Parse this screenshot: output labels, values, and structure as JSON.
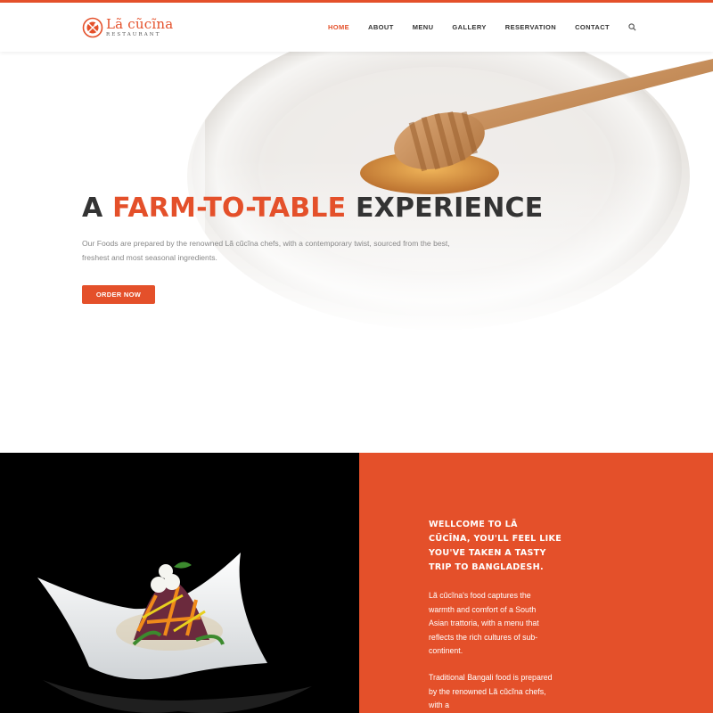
{
  "brand": {
    "name": "Lã cũcĩna",
    "subtitle": "RESTAURANT",
    "logo_icon": "fork-spoon-plate-icon",
    "accent_color": "#e4502a"
  },
  "nav": {
    "items": [
      {
        "label": "HOME",
        "active": true
      },
      {
        "label": "ABOUT"
      },
      {
        "label": "MENU"
      },
      {
        "label": "GALLERY"
      },
      {
        "label": "RESERVATION"
      },
      {
        "label": "CONTACT"
      }
    ],
    "search_icon": "search-icon"
  },
  "hero": {
    "title_prefix": "A ",
    "title_accent": "FARM-TO-TABLE",
    "title_suffix": " EXPERIENCE",
    "description": "Our Foods are prepared by the renowned Lã cũcĩna chefs, with a contemporary twist, sourced from the best, freshest and most seasonal ingredients.",
    "cta_label": "ORDER NOW"
  },
  "welcome": {
    "title": "WELLCOME TO LÃ CŨCĨNA, YOU'LL FEEL LIKE YOU'VE TAKEN A TASTY TRIP TO BANGLADESH.",
    "paragraph_1": "Lã cũcĩna's food captures the warmth and comfort of a South Asian trattoria, with a menu that reflects the rich cultures of sub-continent.",
    "paragraph_2": "Traditional Bangali food is prepared by the renowned Lã cũcĩna chefs, with a"
  }
}
